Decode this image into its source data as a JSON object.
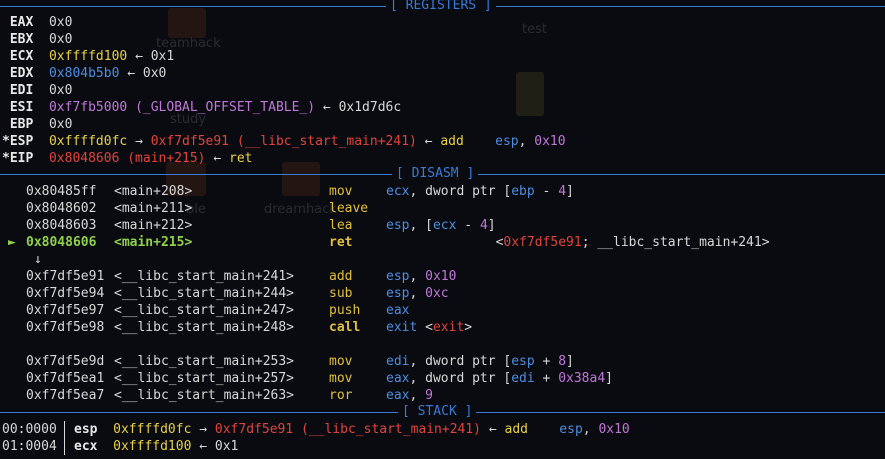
{
  "headers": {
    "registers": "[ REGISTERS ]",
    "disasm": "[ DISASM ]",
    "stack": "[ STACK ]"
  },
  "registers": [
    {
      "star": "",
      "name": "EAX",
      "value": "0x0",
      "value_color": "gy",
      "tail": []
    },
    {
      "star": "",
      "name": "EBX",
      "value": "0x0",
      "value_color": "gy",
      "tail": []
    },
    {
      "star": "",
      "name": "ECX",
      "value": "0xffffd100",
      "value_color": "y",
      "tail": [
        {
          "t": " ← 0x1",
          "c": "gy"
        }
      ]
    },
    {
      "star": "",
      "name": "EDX",
      "value": "0x804b5b0",
      "value_color": "b",
      "tail": [
        {
          "t": " ← 0x0",
          "c": "gy"
        }
      ]
    },
    {
      "star": "",
      "name": "EDI",
      "value": "0x0",
      "value_color": "gy",
      "tail": []
    },
    {
      "star": "",
      "name": "ESI",
      "value": "0xf7fb5000",
      "value_color": "p",
      "tail": [
        {
          "t": " (_GLOBAL_OFFSET_TABLE_)",
          "c": "p"
        },
        {
          "t": " ← 0x1d7d6c",
          "c": "gy"
        }
      ]
    },
    {
      "star": "",
      "name": "EBP",
      "value": "0x0",
      "value_color": "gy",
      "tail": []
    },
    {
      "star": "*",
      "name": "ESP",
      "value": "0xffffd0fc",
      "value_color": "y",
      "tail": [
        {
          "t": " → ",
          "c": "gy"
        },
        {
          "t": "0xf7df5e91 (__libc_start_main+241)",
          "c": "r"
        },
        {
          "t": " ← ",
          "c": "gy"
        },
        {
          "t": "add    ",
          "c": "kw"
        },
        {
          "t": "esp",
          "c": "op"
        },
        {
          "t": ", ",
          "c": "gy"
        },
        {
          "t": "0x10",
          "c": "num"
        }
      ]
    },
    {
      "star": "*",
      "name": "EIP",
      "value": "0x8048606 (main+215)",
      "value_color": "r",
      "tail": [
        {
          "t": " ← ",
          "c": "gy"
        },
        {
          "t": "ret",
          "c": "kw"
        }
      ]
    }
  ],
  "disasm": [
    {
      "marker": "",
      "addr": "0x80485ff",
      "sym": "<main+208>",
      "mn": "mov",
      "ops": [
        {
          "t": "ecx",
          "c": "op"
        },
        {
          "t": ", dword ptr [",
          "c": "gy"
        },
        {
          "t": "ebp",
          "c": "op"
        },
        {
          "t": " - ",
          "c": "gy"
        },
        {
          "t": "4",
          "c": "num"
        },
        {
          "t": "]",
          "c": "gy"
        }
      ],
      "current": false
    },
    {
      "marker": "",
      "addr": "0x8048602",
      "sym": "<main+211>",
      "mn": "leave",
      "ops": [],
      "current": false
    },
    {
      "marker": "",
      "addr": "0x8048603",
      "sym": "<main+212>",
      "mn": "lea",
      "ops": [
        {
          "t": "esp",
          "c": "op"
        },
        {
          "t": ", [",
          "c": "gy"
        },
        {
          "t": "ecx",
          "c": "op"
        },
        {
          "t": " - ",
          "c": "gy"
        },
        {
          "t": "4",
          "c": "num"
        },
        {
          "t": "]",
          "c": "gy"
        }
      ],
      "current": false
    },
    {
      "marker": "►",
      "addr": "0x8048606",
      "sym": "<main+215>",
      "mn": "ret",
      "ops": [
        {
          "t": "              <",
          "c": "gy"
        },
        {
          "t": "0xf7df5e91",
          "c": "r"
        },
        {
          "t": "; __libc_start_main+241>",
          "c": "gy"
        }
      ],
      "current": true
    },
    {
      "marker": "↓",
      "addr": "",
      "sym": "",
      "mn": "",
      "ops": [],
      "current": false
    },
    {
      "marker": "",
      "addr": "0xf7df5e91",
      "sym": "<__libc_start_main+241>",
      "mn": "add",
      "ops": [
        {
          "t": "esp",
          "c": "op"
        },
        {
          "t": ", ",
          "c": "gy"
        },
        {
          "t": "0x10",
          "c": "num"
        }
      ],
      "current": false
    },
    {
      "marker": "",
      "addr": "0xf7df5e94",
      "sym": "<__libc_start_main+244>",
      "mn": "sub",
      "ops": [
        {
          "t": "esp",
          "c": "op"
        },
        {
          "t": ", ",
          "c": "gy"
        },
        {
          "t": "0xc",
          "c": "num"
        }
      ],
      "current": false
    },
    {
      "marker": "",
      "addr": "0xf7df5e97",
      "sym": "<__libc_start_main+247>",
      "mn": "push",
      "ops": [
        {
          "t": "eax",
          "c": "op"
        }
      ],
      "current": false
    },
    {
      "marker": "",
      "addr": "0xf7df5e98",
      "sym": "<__libc_start_main+248>",
      "mn": "call",
      "ops": [
        {
          "t": "exit ",
          "c": "op"
        },
        {
          "t": "<",
          "c": "gy"
        },
        {
          "t": "exit",
          "c": "r"
        },
        {
          "t": ">",
          "c": "gy"
        }
      ],
      "current": false,
      "bold_mn": true
    },
    {
      "marker": "",
      "addr": "",
      "sym": "",
      "mn": "",
      "ops": [],
      "current": false
    },
    {
      "marker": "",
      "addr": "0xf7df5e9d",
      "sym": "<__libc_start_main+253>",
      "mn": "mov",
      "ops": [
        {
          "t": "edi",
          "c": "op"
        },
        {
          "t": ", dword ptr [",
          "c": "gy"
        },
        {
          "t": "esp",
          "c": "op"
        },
        {
          "t": " + ",
          "c": "gy"
        },
        {
          "t": "8",
          "c": "num"
        },
        {
          "t": "]",
          "c": "gy"
        }
      ],
      "current": false
    },
    {
      "marker": "",
      "addr": "0xf7df5ea1",
      "sym": "<__libc_start_main+257>",
      "mn": "mov",
      "ops": [
        {
          "t": "eax",
          "c": "op"
        },
        {
          "t": ", dword ptr [",
          "c": "gy"
        },
        {
          "t": "edi",
          "c": "op"
        },
        {
          "t": " + ",
          "c": "gy"
        },
        {
          "t": "0x38a4",
          "c": "num"
        },
        {
          "t": "]",
          "c": "gy"
        }
      ],
      "current": false
    },
    {
      "marker": "",
      "addr": "0xf7df5ea7",
      "sym": "<__libc_start_main+263>",
      "mn": "ror",
      "ops": [
        {
          "t": "eax",
          "c": "op"
        },
        {
          "t": ", ",
          "c": "gy"
        },
        {
          "t": "9",
          "c": "num"
        }
      ],
      "current": false
    }
  ],
  "stack": [
    {
      "idx": "00:0000",
      "reg": "esp",
      "value": "0xffffd0fc",
      "tail": [
        {
          "t": " → ",
          "c": "gy"
        },
        {
          "t": "0xf7df5e91 (__libc_start_main+241)",
          "c": "r"
        },
        {
          "t": " ← ",
          "c": "gy"
        },
        {
          "t": "add    ",
          "c": "kw"
        },
        {
          "t": "esp",
          "c": "op"
        },
        {
          "t": ", ",
          "c": "gy"
        },
        {
          "t": "0x10",
          "c": "num"
        }
      ]
    },
    {
      "idx": "01:0004",
      "reg": "ecx",
      "value": "0xffffd100",
      "tail": [
        {
          "t": " ← 0x1",
          "c": "gy"
        }
      ]
    }
  ],
  "background_labels": [
    "teamhack",
    "test",
    "study",
    "dreamhack",
    "ble"
  ]
}
